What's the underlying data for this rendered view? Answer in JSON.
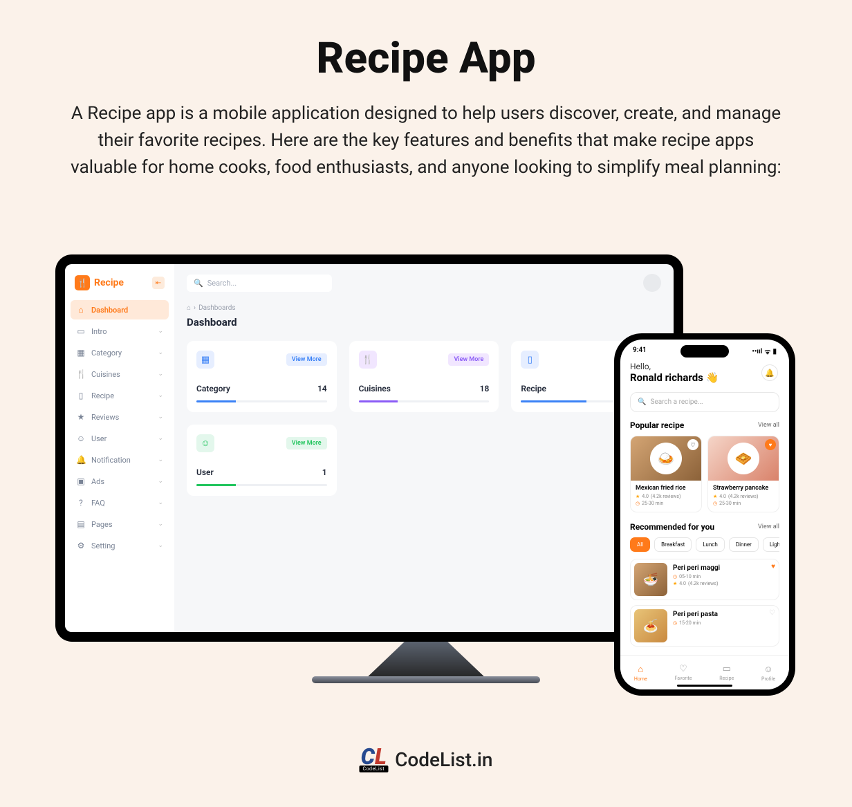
{
  "hero": {
    "title": "Recipe App",
    "description": "A Recipe app is a mobile application designed to help users discover, create, and manage their favorite recipes. Here are the key features and benefits that make recipe apps valuable for home cooks, food enthusiasts, and anyone looking to simplify meal planning:"
  },
  "admin": {
    "brand": "Recipe",
    "search_placeholder": "Search...",
    "nav": [
      {
        "label": "Dashboard",
        "active": true
      },
      {
        "label": "Intro"
      },
      {
        "label": "Category"
      },
      {
        "label": "Cuisines"
      },
      {
        "label": "Recipe"
      },
      {
        "label": "Reviews"
      },
      {
        "label": "User"
      },
      {
        "label": "Notification"
      },
      {
        "label": "Ads"
      },
      {
        "label": "FAQ"
      },
      {
        "label": "Pages"
      },
      {
        "label": "Setting"
      }
    ],
    "breadcrumb_root": "Dashboards",
    "page_title": "Dashboard",
    "cards": [
      {
        "label": "Category",
        "value": "14",
        "vm": "View More"
      },
      {
        "label": "Cuisines",
        "value": "18",
        "vm": "View More"
      },
      {
        "label": "Recipe",
        "value": "",
        "vm": ""
      },
      {
        "label": "User",
        "value": "1",
        "vm": "View More"
      }
    ]
  },
  "mobile": {
    "time": "9:41",
    "hello": "Hello,",
    "name": "Ronald richards 👋",
    "search_placeholder": "Search a recipe...",
    "popular_title": "Popular recipe",
    "view_all": "View all",
    "popular": [
      {
        "name": "Mexican fried rice",
        "rating": "4.0",
        "reviews": "(4.2k reviews)",
        "time": "25-30 min",
        "fav": false
      },
      {
        "name": "Strawberry pancake",
        "rating": "4.0",
        "reviews": "(4.2k reviews)",
        "time": "25-30 min",
        "fav": true
      }
    ],
    "rec_title": "Recommended for you",
    "chips": [
      "All",
      "Breakfast",
      "Lunch",
      "Dinner",
      "Light food"
    ],
    "rec_list": [
      {
        "name": "Peri peri maggi",
        "time": "05-10 min",
        "rating": "4.0",
        "reviews": "(4.2k reviews)",
        "fav": true
      },
      {
        "name": "Peri peri pasta",
        "time": "15-20 min",
        "fav": false
      }
    ],
    "tabs": [
      {
        "label": "Home",
        "on": true
      },
      {
        "label": "Favorite"
      },
      {
        "label": "Recipe"
      },
      {
        "label": "Profile"
      }
    ]
  },
  "footer": {
    "sub": "CodeList",
    "text": "CodeList.in"
  }
}
